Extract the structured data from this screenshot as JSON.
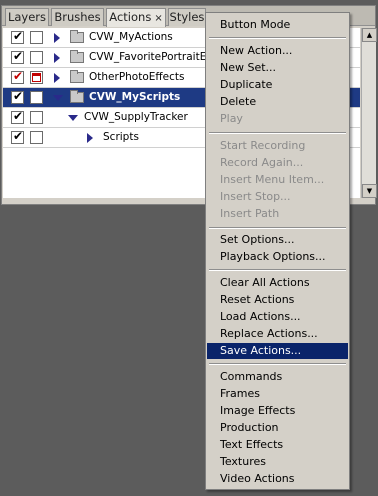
{
  "tabs": [
    {
      "label": "Layers"
    },
    {
      "label": "Brushes"
    },
    {
      "label": "Actions",
      "close": "×"
    },
    {
      "label": "Styles"
    }
  ],
  "actions": [
    {
      "label": "CVW_MyActions",
      "check": "✔"
    },
    {
      "label": "CVW_FavoritePortraitEdit",
      "check": "✔"
    },
    {
      "label": "OtherPhotoEffects",
      "check": "✔"
    },
    {
      "label": "CVW_MyScripts",
      "check": "✔"
    },
    {
      "label": "CVW_SupplyTracker",
      "check": "✔"
    },
    {
      "label": "Scripts",
      "check": "✔"
    }
  ],
  "menu": {
    "items": [
      "Button Mode",
      "New Action...",
      "New Set...",
      "Duplicate",
      "Delete",
      "Play",
      "Start Recording",
      "Record Again...",
      "Insert Menu Item...",
      "Insert Stop...",
      "Insert Path",
      "Set Options...",
      "Playback Options...",
      "Clear All Actions",
      "Reset Actions",
      "Load Actions...",
      "Replace Actions...",
      "Save Actions...",
      "Commands",
      "Frames",
      "Image Effects",
      "Production",
      "Text Effects",
      "Textures",
      "Video Actions"
    ]
  },
  "colors": {
    "selected_row": "#1e3a84",
    "menu_highlight": "#0a246a"
  }
}
